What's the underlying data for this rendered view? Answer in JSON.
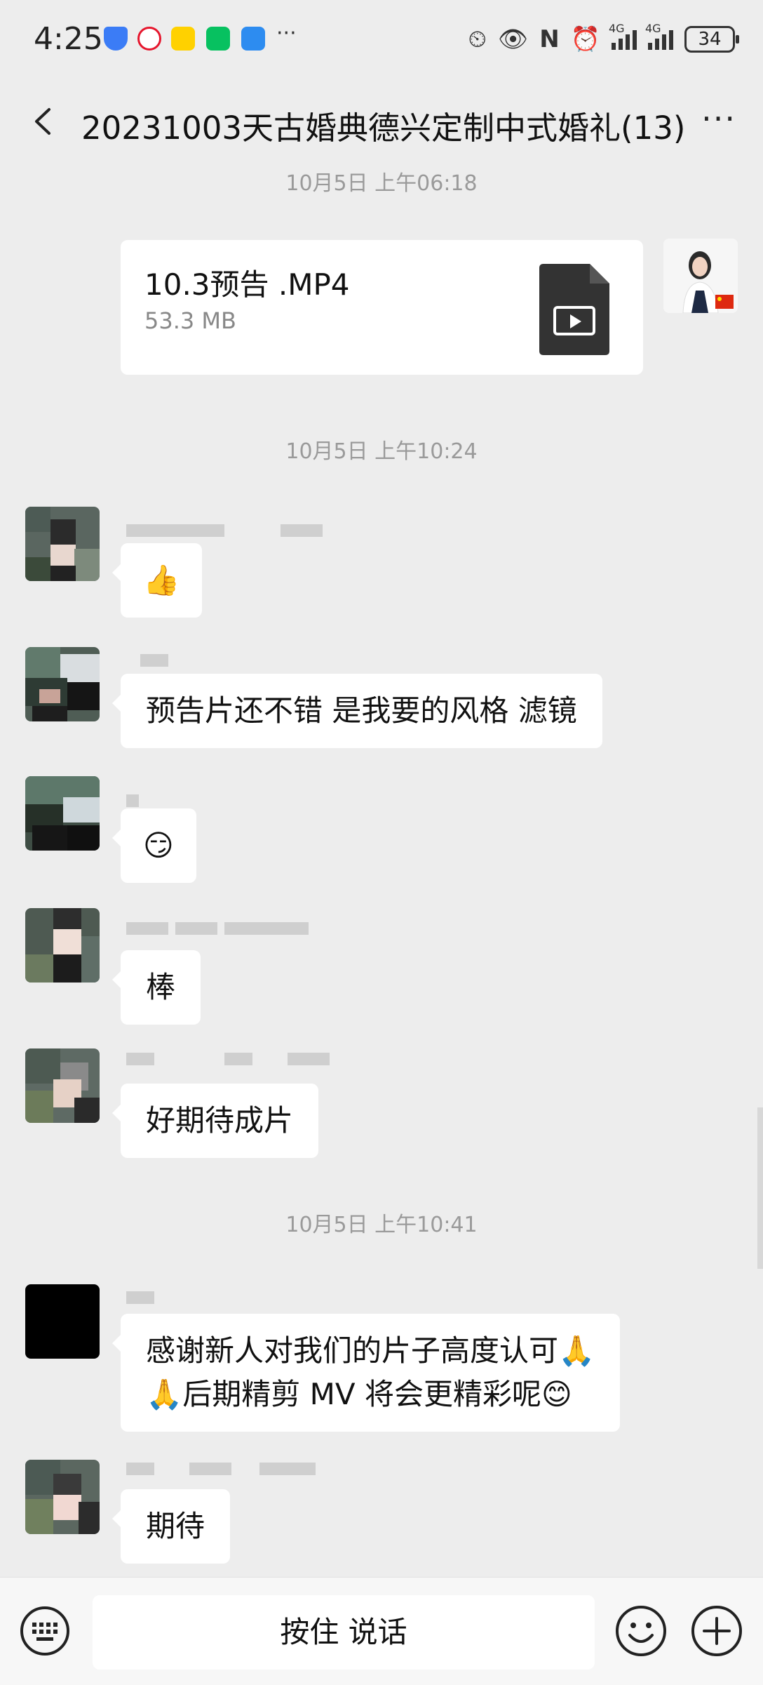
{
  "status_bar": {
    "time": "4:25",
    "battery": "34",
    "network": "4G"
  },
  "header": {
    "title": "20231003天古婚典德兴定制中式婚礼(13)",
    "more": "···"
  },
  "messages": {
    "ts1": "10月5日 上午06:18",
    "file": {
      "name": "10.3预告 .MP4",
      "size": "53.3 MB"
    },
    "ts2": "10月5日 上午10:24",
    "m1": "👍",
    "m2": "预告片还不错 是我要的风格 滤镜",
    "m3": "😏",
    "m4": "棒",
    "m5": "好期待成片",
    "ts3": "10月5日 上午10:41",
    "m6_line1": "感谢新人对我们的片子高度认可🙏",
    "m6_line2": "🙏后期精剪 MV 将会更精彩呢😊",
    "m7": "期待"
  },
  "input_bar": {
    "hold_to_talk": "按住 说话"
  },
  "colors": {
    "background": "#ededed",
    "bubble": "#ffffff",
    "timestamp": "#9a9a9a"
  }
}
